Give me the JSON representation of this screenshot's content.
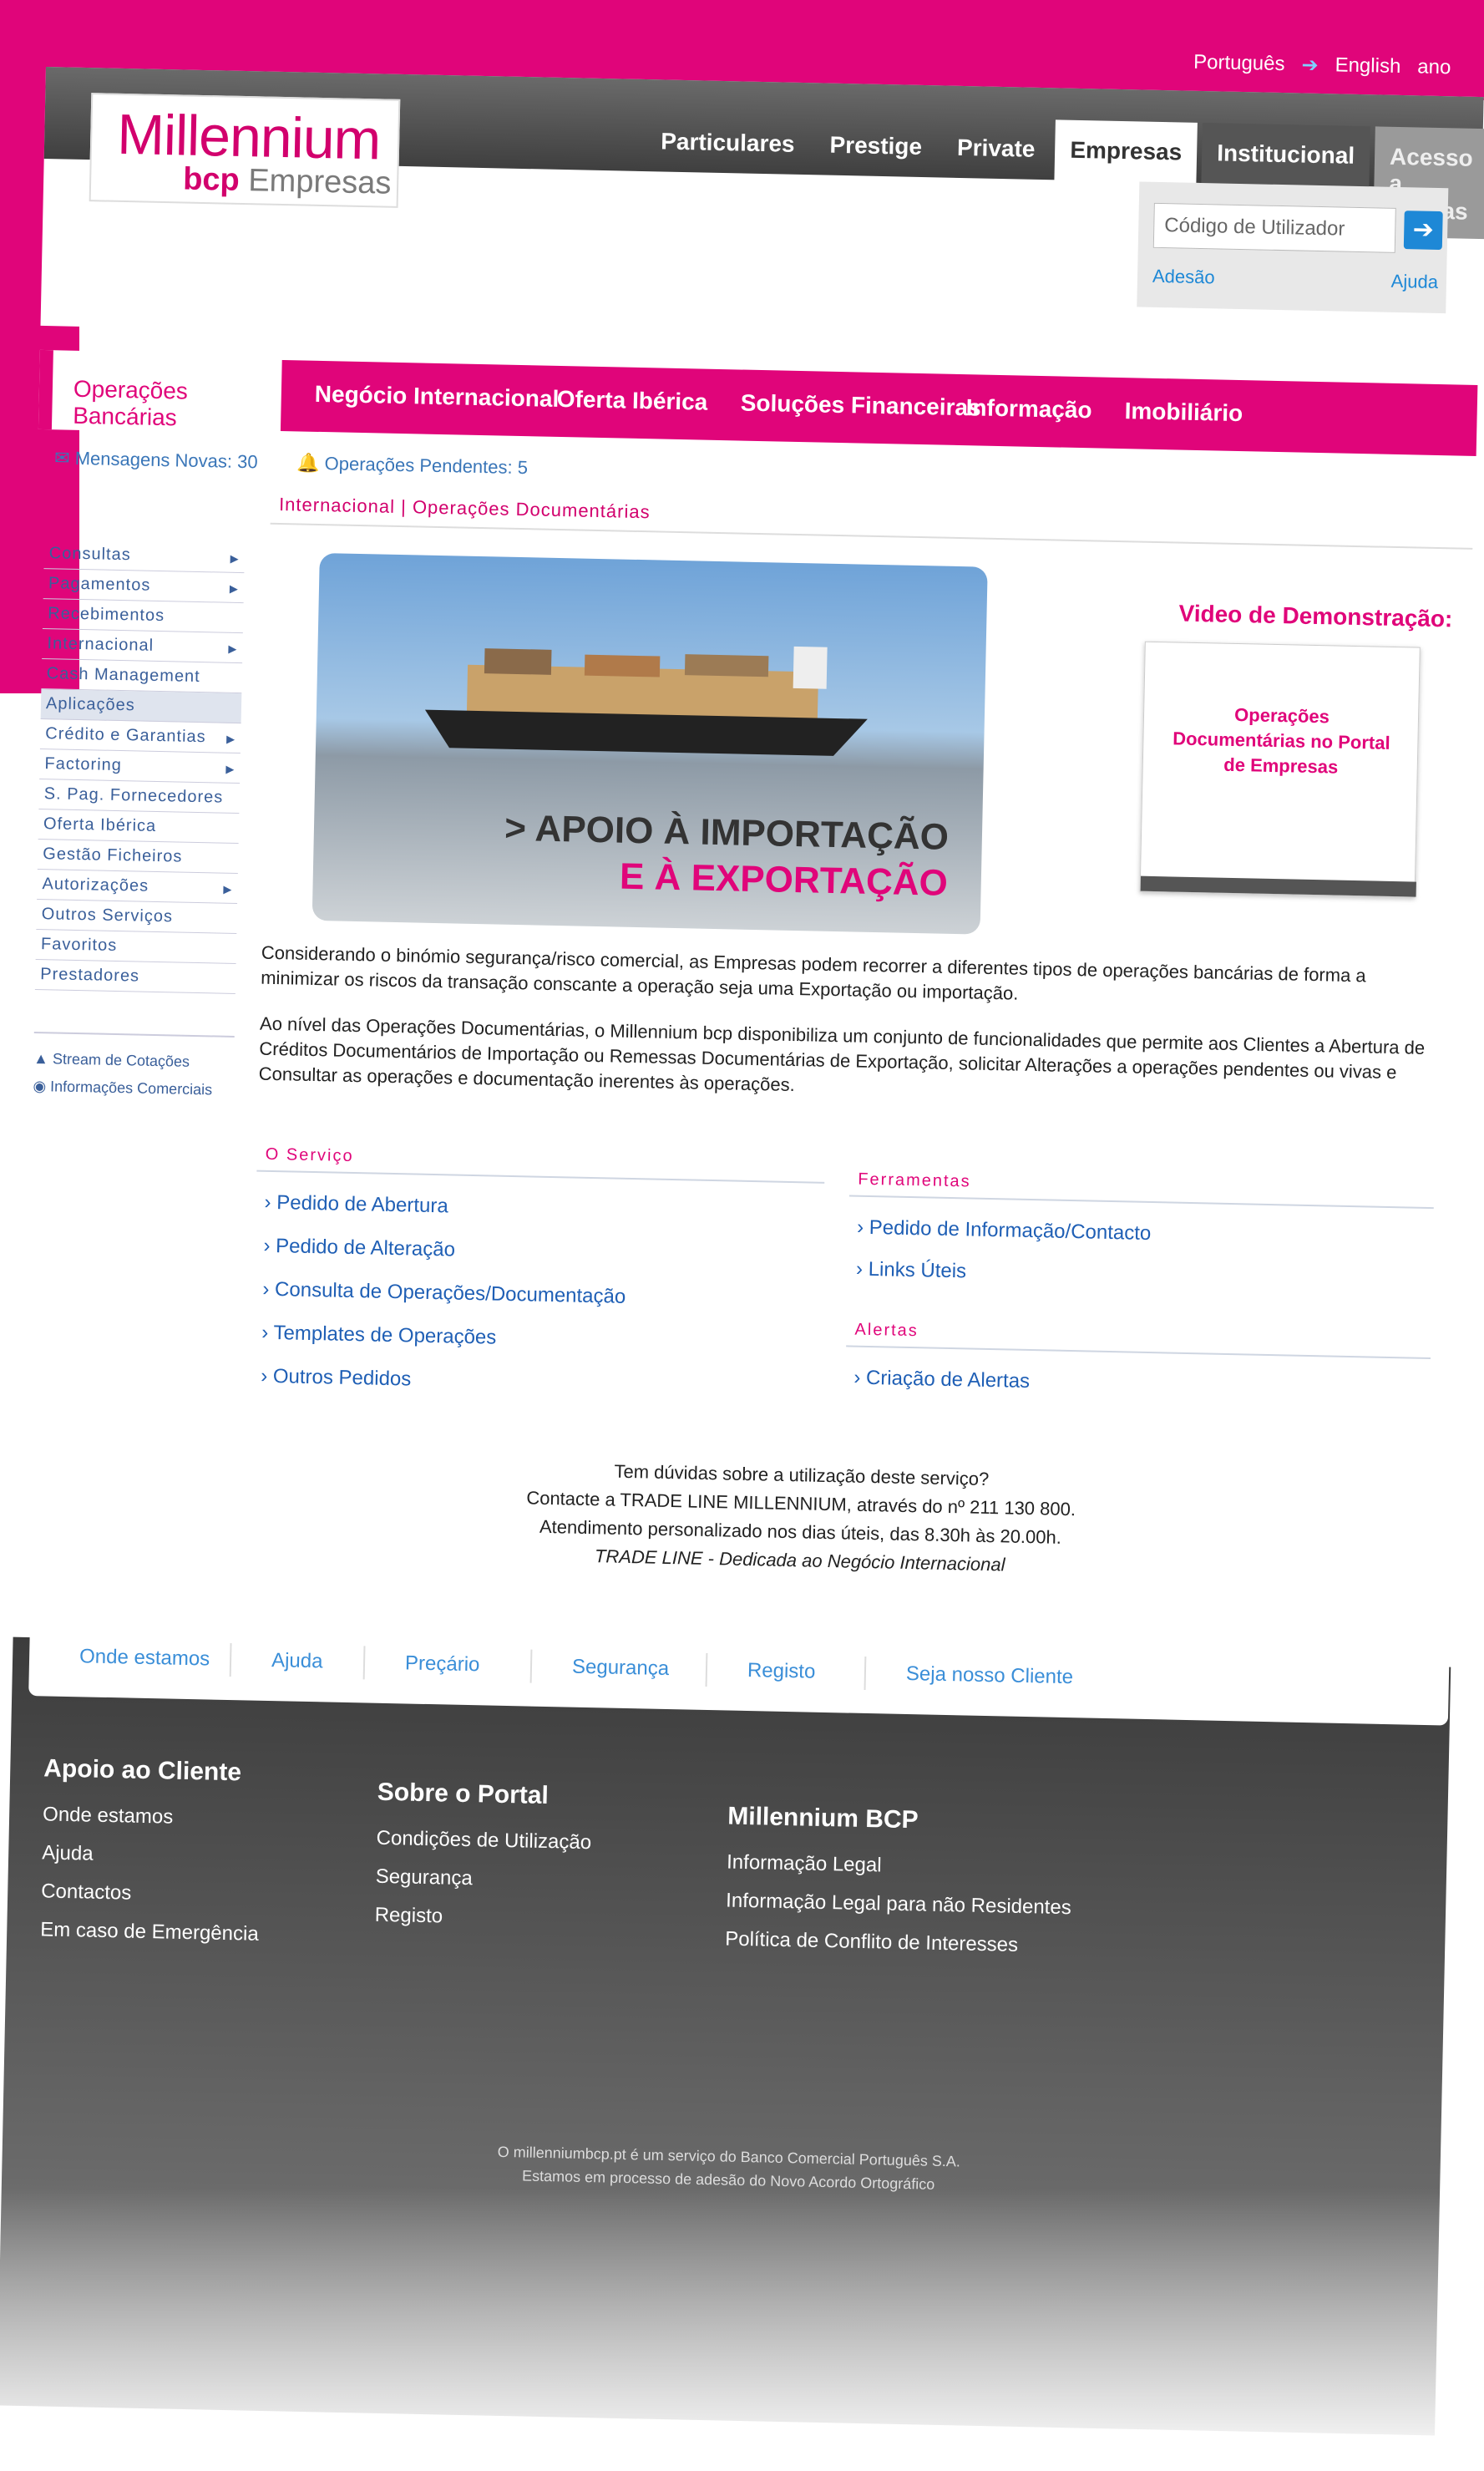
{
  "header": {
    "languages": [
      "Português",
      "English",
      "ano"
    ],
    "logo": {
      "brand": "Millennium",
      "bcp": "bcp",
      "sub": "Empresas"
    },
    "nav": [
      "Particulares",
      "Prestige",
      "Private",
      "Empresas",
      "Institucional",
      "Acesso a Contas"
    ],
    "login": {
      "placeholder": "Código de Utilizador",
      "adesao": "Adesão",
      "ajuda": "Ajuda"
    }
  },
  "tabs": [
    "Operações Bancárias",
    "Negócio Internacional",
    "Oferta Ibérica",
    "Soluções Financeiras",
    "Informação",
    "Imobiliário"
  ],
  "status": {
    "messages": "Mensagens Novas: 30",
    "pending": "Operações Pendentes: 5"
  },
  "breadcrumb": "Internacional | Operações Documentárias",
  "sidebar": {
    "items": [
      "Consultas",
      "Pagamentos",
      "Recebimentos",
      "Internacional",
      "Cash Management",
      "Aplicações",
      "Crédito e Garantias",
      "Factoring",
      "S. Pag. Fornecedores",
      "Oferta Ibérica",
      "Gestão Ficheiros",
      "Autorizações",
      "Outros Serviços",
      "Favoritos",
      "Prestadores"
    ],
    "extras": [
      "Stream de Cotações",
      "Informações Comerciais"
    ]
  },
  "banner": {
    "line1": "> APOIO À IMPORTAÇÃO",
    "line2": "E À EXPORTAÇÃO"
  },
  "video": {
    "title": "Video de Demonstração:",
    "text": "Operações Documentárias no Portal de Empresas"
  },
  "paragraphs": [
    "Considerando o binómio segurança/risco comercial, as Empresas podem recorrer a diferentes tipos de operações bancárias de forma a minimizar os riscos da transação conscante a operação seja uma Exportação ou importação.",
    "Ao nível das Operações Documentárias, o Millennium bcp disponibiliza um conjunto de funcionalidades que permite aos Clientes a Abertura de Créditos Documentários de Importação ou Remessas Documentárias de Exportação, solicitar Alterações a operações pendentes ou vivas e Consultar as operações e documentação inerentes às operações."
  ],
  "servico": {
    "title": "O Serviço",
    "links": [
      "Pedido de Abertura",
      "Pedido de Alteração",
      "Consulta de Operações/Documentação",
      "Templates de Operações",
      "Outros Pedidos"
    ]
  },
  "ferramentas": {
    "title": "Ferramentas",
    "links": [
      "Pedido de Informação/Contacto",
      "Links Úteis"
    ]
  },
  "alertas": {
    "title": "Alertas",
    "links": [
      "Criação de Alertas"
    ]
  },
  "help": {
    "line1": "Tem dúvidas sobre a utilização deste serviço?",
    "line2": "Contacte a TRADE LINE MILLENNIUM, através do nº 211 130 800.",
    "line3": "Atendimento personalizado nos dias úteis, das 8.30h às 20.00h.",
    "line4": "TRADE LINE - Dedicada ao Negócio Internacional"
  },
  "footer": {
    "tabs": [
      "Onde estamos",
      "Ajuda",
      "Preçário",
      "Segurança",
      "Registo",
      "Seja nosso Cliente"
    ],
    "cols": [
      {
        "title": "Apoio ao Cliente",
        "links": [
          "Onde estamos",
          "Ajuda",
          "Contactos",
          "Em caso de Emergência"
        ]
      },
      {
        "title": "Sobre o Portal",
        "links": [
          "Condições de Utilização",
          "Segurança",
          "Registo"
        ]
      },
      {
        "title": "Millennium BCP",
        "links": [
          "Informação Legal",
          "Informação Legal para não Residentes",
          "Política de Conflito de Interesses"
        ]
      }
    ],
    "legal1": "O millenniumbcp.pt é um serviço do Banco Comercial Português S.A.",
    "legal2": "Estamos em processo de adesão do Novo Acordo Ortográfico"
  },
  "colors": {
    "brand": "#e0057a",
    "link": "#1f5fb5"
  }
}
